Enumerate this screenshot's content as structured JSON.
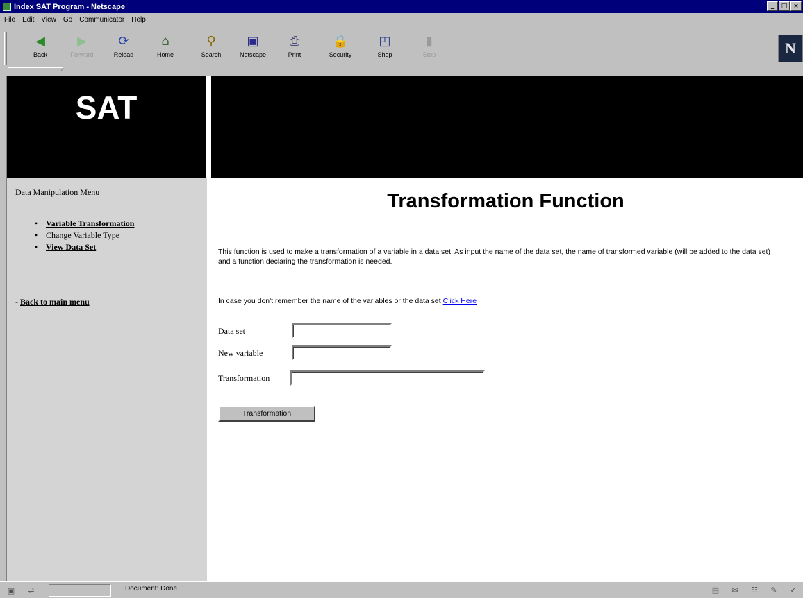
{
  "window": {
    "title": "Index SAT Program - Netscape"
  },
  "menubar": [
    "File",
    "Edit",
    "View",
    "Go",
    "Communicator",
    "Help"
  ],
  "toolbar": {
    "buttons": [
      {
        "label": "Back",
        "icon": "back-arrow-icon",
        "glyph": "◀"
      },
      {
        "label": "Forward",
        "icon": "forward-arrow-icon",
        "glyph": "▶"
      },
      {
        "label": "Reload",
        "icon": "reload-icon",
        "glyph": "⟳"
      },
      {
        "label": "Home",
        "icon": "home-icon",
        "glyph": "⌂"
      },
      {
        "label": "Search",
        "icon": "search-icon",
        "glyph": "⚲"
      },
      {
        "label": "Netscape",
        "icon": "netscape-icon",
        "glyph": "▣"
      },
      {
        "label": "Print",
        "icon": "print-icon",
        "glyph": "⎙"
      },
      {
        "label": "Security",
        "icon": "security-lock-icon",
        "glyph": "🔒"
      },
      {
        "label": "Shop",
        "icon": "shop-bag-icon",
        "glyph": "◰"
      },
      {
        "label": "Stop",
        "icon": "stop-icon",
        "glyph": "▮"
      }
    ],
    "brand": "N"
  },
  "header": {
    "logo": "SAT"
  },
  "sidebar": {
    "title": "Data Manipulation Menu",
    "items": [
      {
        "label": "Variable Transformation",
        "link": true
      },
      {
        "label": "Change Variable Type",
        "link": false
      },
      {
        "label": "View Data Set",
        "link": true
      }
    ],
    "back_prefix": "- ",
    "back_label": "Back to main menu"
  },
  "main": {
    "title": "Transformation Function",
    "description": "This function is used to make a transformation of a variable in a data set. As input the name of the data set, the name of transformed variable (will be added to the data set) and a function declaring the transformation is needed.",
    "remember_text": "In case you don't remember the name of the variables or the data set ",
    "remember_link": "Click Here",
    "form": {
      "dataset_label": "Data set",
      "dataset_value": "",
      "newvar_label": "New variable",
      "newvar_value": "",
      "transform_label": "Transformation",
      "transform_value": ""
    },
    "submit_label": "Transformation"
  },
  "statusbar": {
    "text": "Document: Done"
  },
  "colors": {
    "titlebar": "#00007b",
    "link": "#0000ee",
    "header_bg": "#000000",
    "sidebar_bg": "#d4d4d4"
  }
}
